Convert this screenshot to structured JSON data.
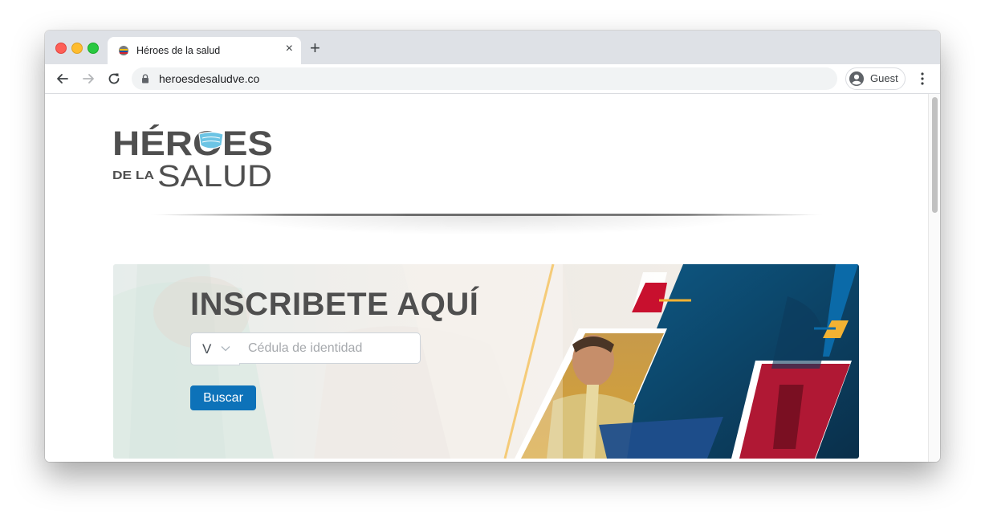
{
  "browser": {
    "tab_title": "Héroes de la salud",
    "tab_close": "×",
    "new_tab": "+",
    "url": "heroesdesaludve.co",
    "profile_label": "Guest"
  },
  "page": {
    "logo": {
      "line1": "HÉROES",
      "line2_small": "DE LA",
      "line2_large": "SALUD"
    },
    "banner": {
      "title": "INSCRIBETE AQUÍ",
      "doc_type_selected": "V",
      "cedula_placeholder": "Cédula de identidad",
      "cedula_value": "",
      "search_button": "Buscar"
    }
  },
  "colors": {
    "accent_blue": "#0d72b9",
    "brand_gray": "#4f4f4f",
    "mask_blue": "#6cc4e4",
    "stripe_red": "#c8102e",
    "stripe_yellow": "#f2b233",
    "stripe_blue": "#0b5f93"
  },
  "icons": [
    "back-arrow-icon",
    "forward-arrow-icon",
    "reload-icon",
    "lock-icon",
    "profile-icon",
    "kebab-menu-icon",
    "chevron-down-icon",
    "venezuela-flag-favicon"
  ]
}
